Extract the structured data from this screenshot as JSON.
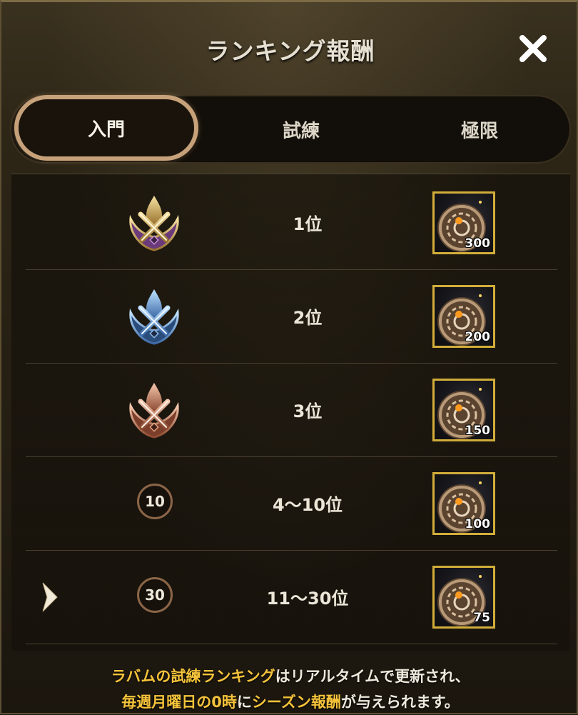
{
  "title": "ランキング報酬",
  "close_icon": "close-icon",
  "tabs": [
    {
      "label": "入門",
      "active": true
    },
    {
      "label": "試練",
      "active": false
    },
    {
      "label": "極限",
      "active": false
    }
  ],
  "rows": [
    {
      "icon": "gold-crossed-swords-emblem-icon",
      "rank": "1位",
      "reward_icon": "bronze-medallion-icon",
      "quantity": "300"
    },
    {
      "icon": "blue-crossed-swords-emblem-icon",
      "rank": "2位",
      "reward_icon": "bronze-medallion-icon",
      "quantity": "200"
    },
    {
      "icon": "copper-crossed-swords-emblem-icon",
      "rank": "3位",
      "reward_icon": "bronze-medallion-icon",
      "quantity": "150"
    },
    {
      "badge": "10",
      "rank": "4〜10位",
      "reward_icon": "bronze-medallion-icon",
      "quantity": "100"
    },
    {
      "badge": "30",
      "rank": "11〜30位",
      "reward_icon": "bronze-medallion-icon",
      "quantity": "75",
      "current": true
    }
  ],
  "footer": {
    "line1_highlight": "ラバムの試練ランキング",
    "line1_rest": "はリアルタイムで更新され、",
    "line2_highlight1": "毎週月曜日の0時",
    "line2_mid": "に",
    "line2_highlight2": "シーズン報酬",
    "line2_rest": "が与えられます。"
  },
  "colors": {
    "accent": "#c6a179",
    "highlight_text": "#f5c33b",
    "reward_border": "#d2ad3a"
  }
}
